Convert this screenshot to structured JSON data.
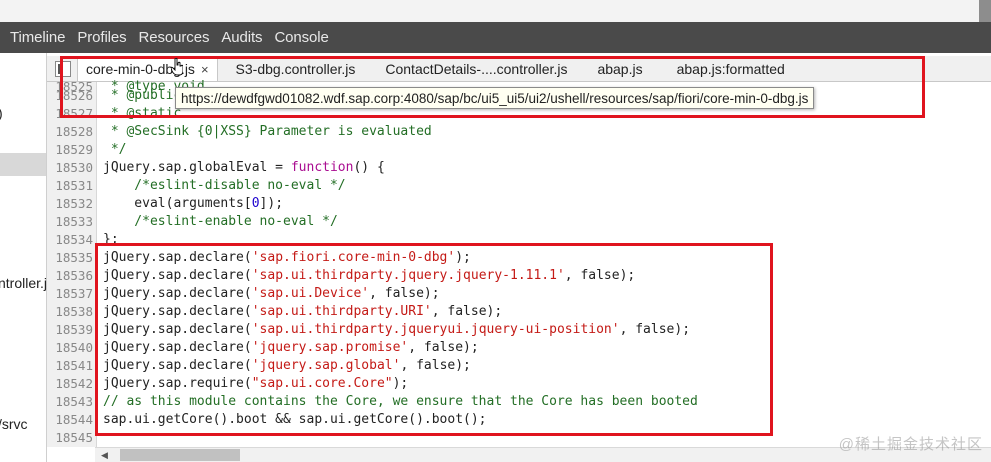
{
  "menubar": {
    "tabs": [
      "Timeline",
      "Profiles",
      "Resources",
      "Audits",
      "Console"
    ]
  },
  "sidebar": {
    "items": [
      ")",
      "ntroller.j",
      "/srvc"
    ]
  },
  "file_tabs": {
    "active_label": "core-min-0-dbg.js",
    "close_glyph": "×",
    "others": [
      "S3-dbg.controller.js",
      "ContactDetails-....controller.js",
      "abap.js",
      "abap.js:formatted"
    ]
  },
  "tooltip": {
    "url": "https://dewdfgwd01082.wdf.sap.corp:4080/sap/bc/ui5_ui5/ui2/ushell/resources/sap/fiori/core-min-0-dbg.js"
  },
  "code": {
    "line_numbers": [
      "18525",
      "18526",
      "18527",
      "18528",
      "18529",
      "18530",
      "18531",
      "18532",
      "18533",
      "18534",
      "18535",
      "18536",
      "18537",
      "18538",
      "18539",
      "18540",
      "18541",
      "18542",
      "18543",
      "18544",
      "18545"
    ],
    "l18525": " * @type void",
    "l18526": " * @public",
    "l18527": " * @static",
    "l18528": " * @SecSink {0|XSS} Parameter is evaluated",
    "l18529": " */",
    "l18530_a": "jQuery.sap.globalEval = ",
    "l18530_kw": "function",
    "l18530_b": "() {",
    "l18531": "    /*eslint-disable no-eval */",
    "l18532_a": "    eval(arguments[",
    "l18532_num": "0",
    "l18532_b": "]);",
    "l18533": "    /*eslint-enable no-eval */",
    "l18534": "};",
    "declare_prefix": "jQuery.sap.declare(",
    "require_prefix": "jQuery.sap.require(",
    "l18535_str": "'sap.fiori.core-min-0-dbg'",
    "l18535_end": ");",
    "l18536_str": "'sap.ui.thirdparty.jquery.jquery-1.11.1'",
    "l18537_str": "'sap.ui.Device'",
    "l18538_str": "'sap.ui.thirdparty.URI'",
    "l18539_str": "'sap.ui.thirdparty.jqueryui.jquery-ui-position'",
    "l18540_str": "'jquery.sap.promise'",
    "l18541_str": "'jquery.sap.global'",
    "false_end": ", false);",
    "l18542_str": "\"sap.ui.core.Core\"",
    "l18542_end": ");",
    "l18543": "// as this module contains the Core, we ensure that the Core has been booted",
    "l18544": "sap.ui.getCore().boot && sap.ui.getCore().boot();",
    "l18545": ""
  },
  "watermark": "@稀土掘金技术社区",
  "colors": {
    "highlight_border": "#e0141e",
    "string": "#c41a16",
    "comment": "#236e25",
    "keyword": "#aa0d91",
    "number": "#1c00cf"
  }
}
